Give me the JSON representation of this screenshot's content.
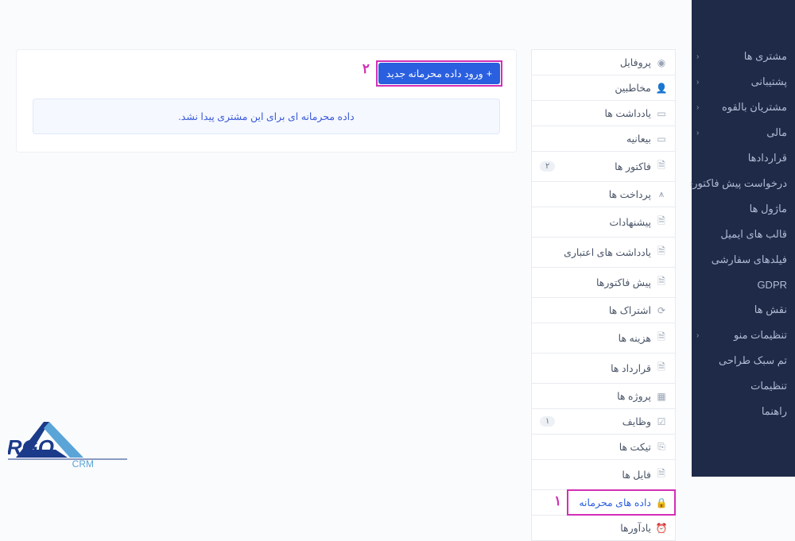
{
  "sidebar": {
    "items": [
      {
        "label": "مشتری ها",
        "expandable": true
      },
      {
        "label": "پشتیبانی",
        "expandable": true
      },
      {
        "label": "مشتریان بالقوه",
        "expandable": true
      },
      {
        "label": "مالی",
        "expandable": true
      },
      {
        "label": "قراردادها",
        "expandable": false
      },
      {
        "label": "درخواست پیش فاکتور",
        "expandable": true
      },
      {
        "label": "ماژول ها",
        "expandable": false
      },
      {
        "label": "قالب های ایمیل",
        "expandable": false
      },
      {
        "label": "فیلدهای سفارشی",
        "expandable": false
      },
      {
        "label": "GDPR",
        "expandable": false
      },
      {
        "label": "نقش ها",
        "expandable": false
      },
      {
        "label": "تنظیمات منو",
        "expandable": true
      },
      {
        "label": "تم سبک طراحی",
        "expandable": false
      },
      {
        "label": "تنظیمات",
        "expandable": false
      },
      {
        "label": "راهنما",
        "expandable": false
      }
    ]
  },
  "tabs": [
    {
      "icon": "user-circle",
      "label": "پروفایل"
    },
    {
      "icon": "users",
      "label": "مخاطبین"
    },
    {
      "icon": "note",
      "label": "یادداشت ها"
    },
    {
      "icon": "doc",
      "label": "بیعانیه"
    },
    {
      "icon": "file",
      "label": "فاکتور ها",
      "badge": "۲"
    },
    {
      "icon": "chart",
      "label": "پرداخت ها"
    },
    {
      "icon": "file",
      "label": "پیشنهادات"
    },
    {
      "icon": "file",
      "label": "یادداشت های اعتباری"
    },
    {
      "icon": "file",
      "label": "پیش فاکتورها"
    },
    {
      "icon": "refresh",
      "label": "اشتراک ها"
    },
    {
      "icon": "file",
      "label": "هزینه ها"
    },
    {
      "icon": "file",
      "label": "قرارداد ها"
    },
    {
      "icon": "grid",
      "label": "پروژه ها"
    },
    {
      "icon": "check",
      "label": "وظایف",
      "badge": "۱"
    },
    {
      "icon": "ticket",
      "label": "تیکت ها"
    },
    {
      "icon": "file",
      "label": "فایل ها"
    },
    {
      "icon": "lock",
      "label": "داده های محرمانه",
      "active": true
    },
    {
      "icon": "bell",
      "label": "یادآورها"
    }
  ],
  "main": {
    "new_button": "ورود داده محرمانه جدید",
    "alert": "داده محرمانه ای برای این مشتری پیدا نشد."
  },
  "markers": {
    "m1": "۱",
    "m2": "۲"
  },
  "logo": {
    "brand_main": "RGO",
    "brand_sub": "CRM"
  }
}
